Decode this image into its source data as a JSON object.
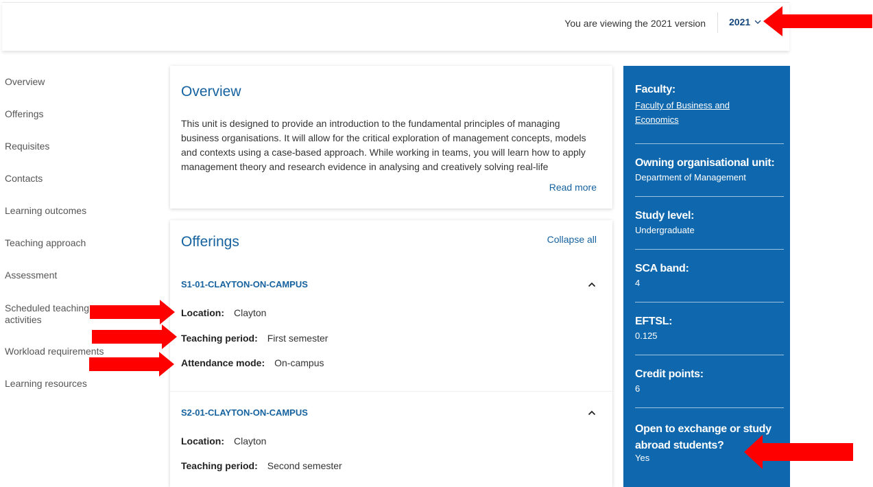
{
  "header": {
    "version_text": "You are viewing the 2021 version",
    "selected_year": "2021"
  },
  "sidenav": {
    "items": [
      {
        "label": "Overview"
      },
      {
        "label": "Offerings"
      },
      {
        "label": "Requisites"
      },
      {
        "label": "Contacts"
      },
      {
        "label": "Learning outcomes"
      },
      {
        "label": "Teaching approach"
      },
      {
        "label": "Assessment"
      },
      {
        "label": "Scheduled teaching activities"
      },
      {
        "label": "Workload requirements"
      },
      {
        "label": "Learning resources"
      }
    ]
  },
  "overview": {
    "title": "Overview",
    "text": "This unit is designed to provide an introduction to the fundamental principles of managing business organisations. It will allow for the critical exploration of management concepts, models and contexts using a case-based approach. While working in teams, you will learn how to apply management theory and research evidence in analysing and creatively solving real-life",
    "read_more": "Read more"
  },
  "offerings": {
    "title": "Offerings",
    "collapse_all": "Collapse all",
    "items": [
      {
        "code": "S1-01-CLAYTON-ON-CAMPUS",
        "location_label": "Location:",
        "location": "Clayton",
        "period_label": "Teaching period:",
        "period": "First semester",
        "mode_label": "Attendance mode:",
        "mode": "On-campus"
      },
      {
        "code": "S2-01-CLAYTON-ON-CAMPUS",
        "location_label": "Location:",
        "location": "Clayton",
        "period_label": "Teaching period:",
        "period": "Second semester"
      }
    ]
  },
  "facts": {
    "faculty_label": "Faculty:",
    "faculty_line1": "Faculty of Business and",
    "faculty_line2": "Economics",
    "owning_label": "Owning organisational unit:",
    "owning": "Department of Management",
    "level_label": "Study level:",
    "level": "Undergraduate",
    "sca_label": "SCA band:",
    "sca": "4",
    "eftsl_label": "EFTSL:",
    "eftsl": "0.125",
    "credit_label": "Credit points:",
    "credit": "6",
    "exchange_label_line1": "Open to exchange or study",
    "exchange_label_line2": "abroad students?",
    "exchange": "Yes"
  },
  "colors": {
    "accent_blue": "#16629f",
    "panel_blue": "#0f67ad",
    "annotation_red": "#ff0000"
  }
}
